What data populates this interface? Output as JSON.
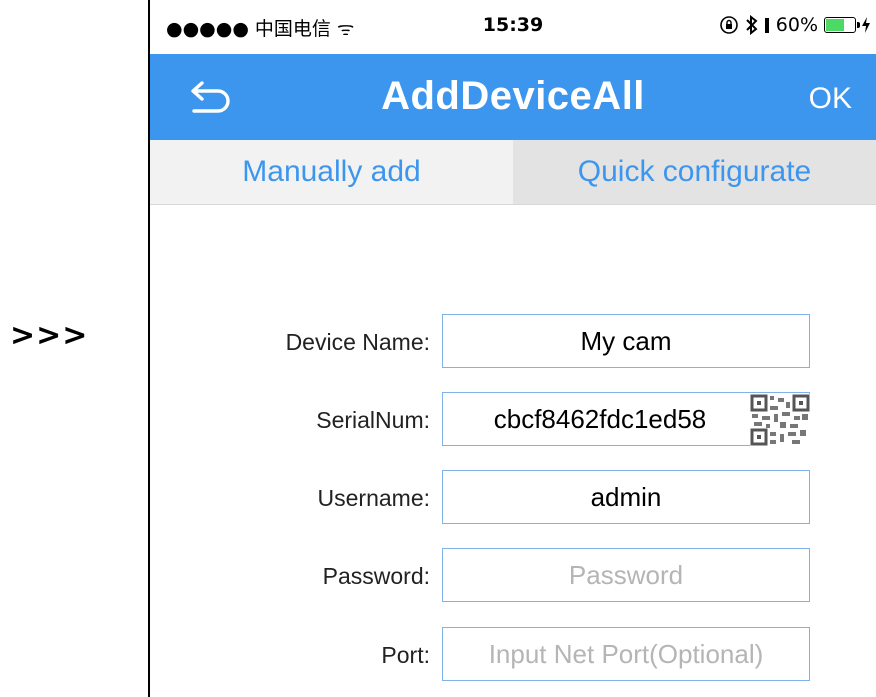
{
  "annotation": {
    "arrows": ">>>"
  },
  "status_bar": {
    "carrier": "●●●●● 中国电信 ᯤ",
    "time": "15:39",
    "battery": "60%",
    "icons": [
      "orientation-lock-icon",
      "bluetooth-icon",
      "battery-icon",
      "charging-icon"
    ]
  },
  "nav": {
    "title": "AddDeviceAll",
    "ok_label": "OK",
    "back_icon": "back-arrow-icon"
  },
  "tabs": [
    {
      "label": "Manually add"
    },
    {
      "label": "Quick configurate"
    }
  ],
  "form": {
    "device_name": {
      "label": "Device Name:",
      "value": "My cam",
      "placeholder": ""
    },
    "serial": {
      "label": "SerialNum:",
      "value": "cbcf8462fdc1ed58",
      "placeholder": "",
      "icon": "qr-code-icon"
    },
    "username": {
      "label": "Username:",
      "value": "admin",
      "placeholder": ""
    },
    "password": {
      "label": "Password:",
      "value": "",
      "placeholder": "Password"
    },
    "port": {
      "label": "Port:",
      "value": "",
      "placeholder": "Input Net Port(Optional)"
    }
  },
  "colors": {
    "accent": "#3d96ee",
    "field_border": "#7fb3e8",
    "tab_manual_bg": "#f2f2f2",
    "tab_quick_bg": "#e3e3e3",
    "battery_fill": "#4cd964"
  }
}
